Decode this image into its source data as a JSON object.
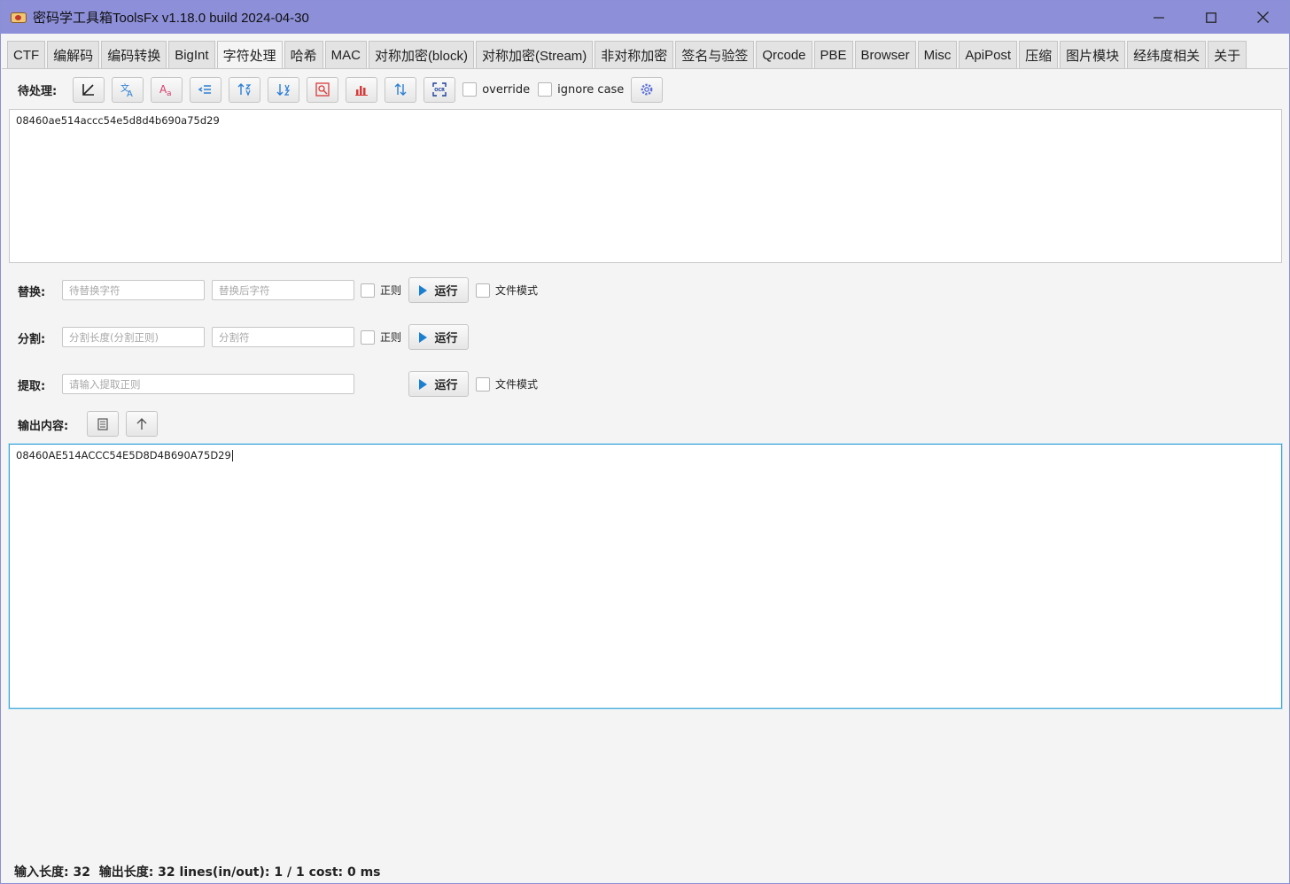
{
  "window": {
    "title": "密码学工具箱ToolsFx v1.18.0 build 2024-04-30",
    "minimize_icon": "minimize-icon",
    "maximize_icon": "maximize-icon",
    "close_icon": "close-icon"
  },
  "tabs": [
    {
      "label": "CTF"
    },
    {
      "label": "编解码"
    },
    {
      "label": "编码转换"
    },
    {
      "label": "BigInt"
    },
    {
      "label": "字符处理"
    },
    {
      "label": "哈希"
    },
    {
      "label": "MAC"
    },
    {
      "label": "对称加密(block)"
    },
    {
      "label": "对称加密(Stream)"
    },
    {
      "label": "非对称加密"
    },
    {
      "label": "签名与验签"
    },
    {
      "label": "Qrcode"
    },
    {
      "label": "PBE"
    },
    {
      "label": "Browser"
    },
    {
      "label": "Misc"
    },
    {
      "label": "ApiPost"
    },
    {
      "label": "压缩"
    },
    {
      "label": "图片模块"
    },
    {
      "label": "经纬度相关"
    },
    {
      "label": "关于"
    }
  ],
  "active_tab": "字符处理",
  "toolbar": {
    "label": "待处理:",
    "override_label": "override",
    "ignore_case_label": "ignore case",
    "icons": [
      "import-icon",
      "translate-icon",
      "case-icon",
      "indent-icon",
      "sort-asc-icon",
      "sort-desc-icon",
      "remove-duplicate-icon",
      "chart-icon",
      "swap-icon",
      "ocr-icon",
      "settings-icon"
    ]
  },
  "input": {
    "value": "08460ae514accc54e5d8d4b690a75d29"
  },
  "replace": {
    "label": "替换:",
    "find_placeholder": "待替换字符",
    "replace_placeholder": "替换后字符",
    "regex_label": "正则",
    "run_label": "运行",
    "file_mode_label": "文件模式"
  },
  "split": {
    "label": "分割:",
    "length_placeholder": "分割长度(分割正则)",
    "separator_placeholder": "分割符",
    "regex_label": "正则",
    "run_label": "运行"
  },
  "extract": {
    "label": "提取:",
    "regex_placeholder": "请输入提取正则",
    "run_label": "运行",
    "file_mode_label": "文件模式"
  },
  "output": {
    "label": "输出内容:",
    "value": "08460AE514ACCC54E5D8D4B690A75D29"
  },
  "status": {
    "text": "输入长度: 32  输出长度: 32 lines(in/out): 1 / 1 cost: 0 ms"
  },
  "colors": {
    "titlebar": "#8d8fd9",
    "focus_border": "#3aa3d8",
    "accent_blue": "#1a7fd0"
  }
}
